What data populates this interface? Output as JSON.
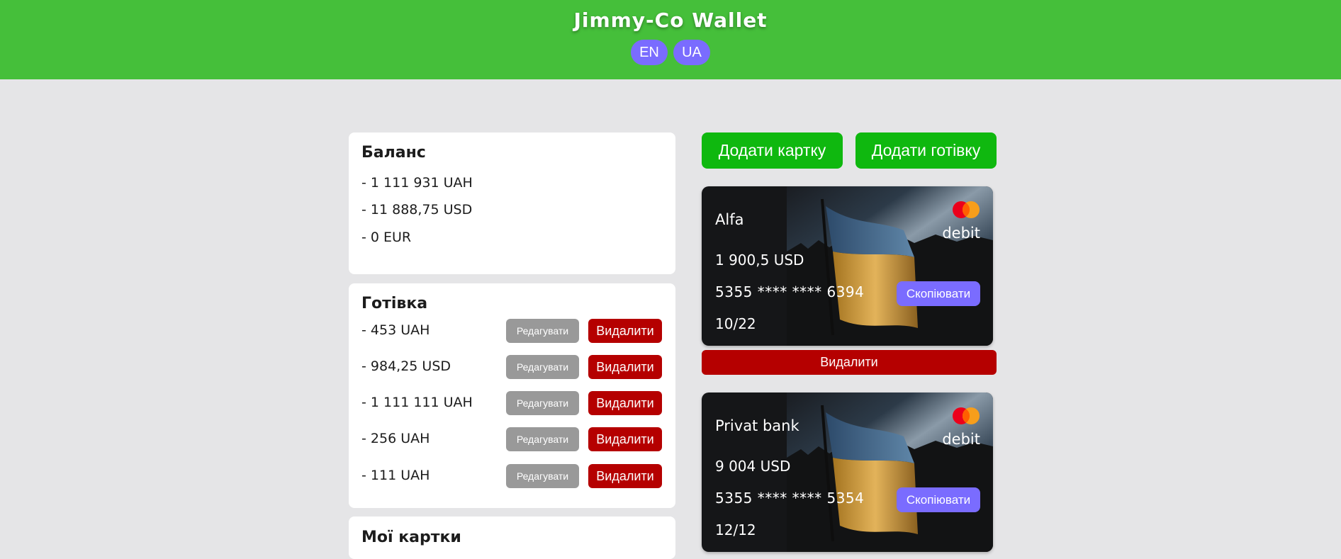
{
  "app": {
    "title": "Jimmy-Co Wallet",
    "languages": [
      "EN",
      "UA"
    ]
  },
  "balance": {
    "title": "Баланс",
    "lines": [
      "- 1 111 931 UAH",
      "- 11 888,75 USD",
      "- 0 EUR"
    ]
  },
  "cash": {
    "title": "Готівка",
    "edit_label": "Редагувати",
    "delete_label": "Видалити",
    "items": [
      "- 453 UAH",
      "- 984,25 USD",
      "- 1 111 111 UAH",
      "- 256 UAH",
      "- 111 UAH"
    ]
  },
  "my_cards": {
    "title": "Мої картки"
  },
  "actions": {
    "add_card": "Додати картку",
    "add_cash": "Додати готівку"
  },
  "cards": [
    {
      "bank": "Alfa",
      "type": "debit",
      "balance": "1 900,5 USD",
      "number": "5355 **** **** 6394",
      "expiry": "10/22",
      "copy_label": "Скопіювати",
      "delete_label": "Видалити"
    },
    {
      "bank": "Privat bank",
      "type": "debit",
      "balance": "9 004 USD",
      "number": "5355 **** **** 5354",
      "expiry": "12/12",
      "copy_label": "Скопіювати"
    }
  ],
  "colors": {
    "header": "#45bf3a",
    "page_bg": "#e5e5e7",
    "lang_button": "#7a6cff",
    "add_button": "#0fb80f",
    "edit_button": "#999999",
    "delete_button": "#b50000",
    "copy_button": "#7a6cff"
  }
}
